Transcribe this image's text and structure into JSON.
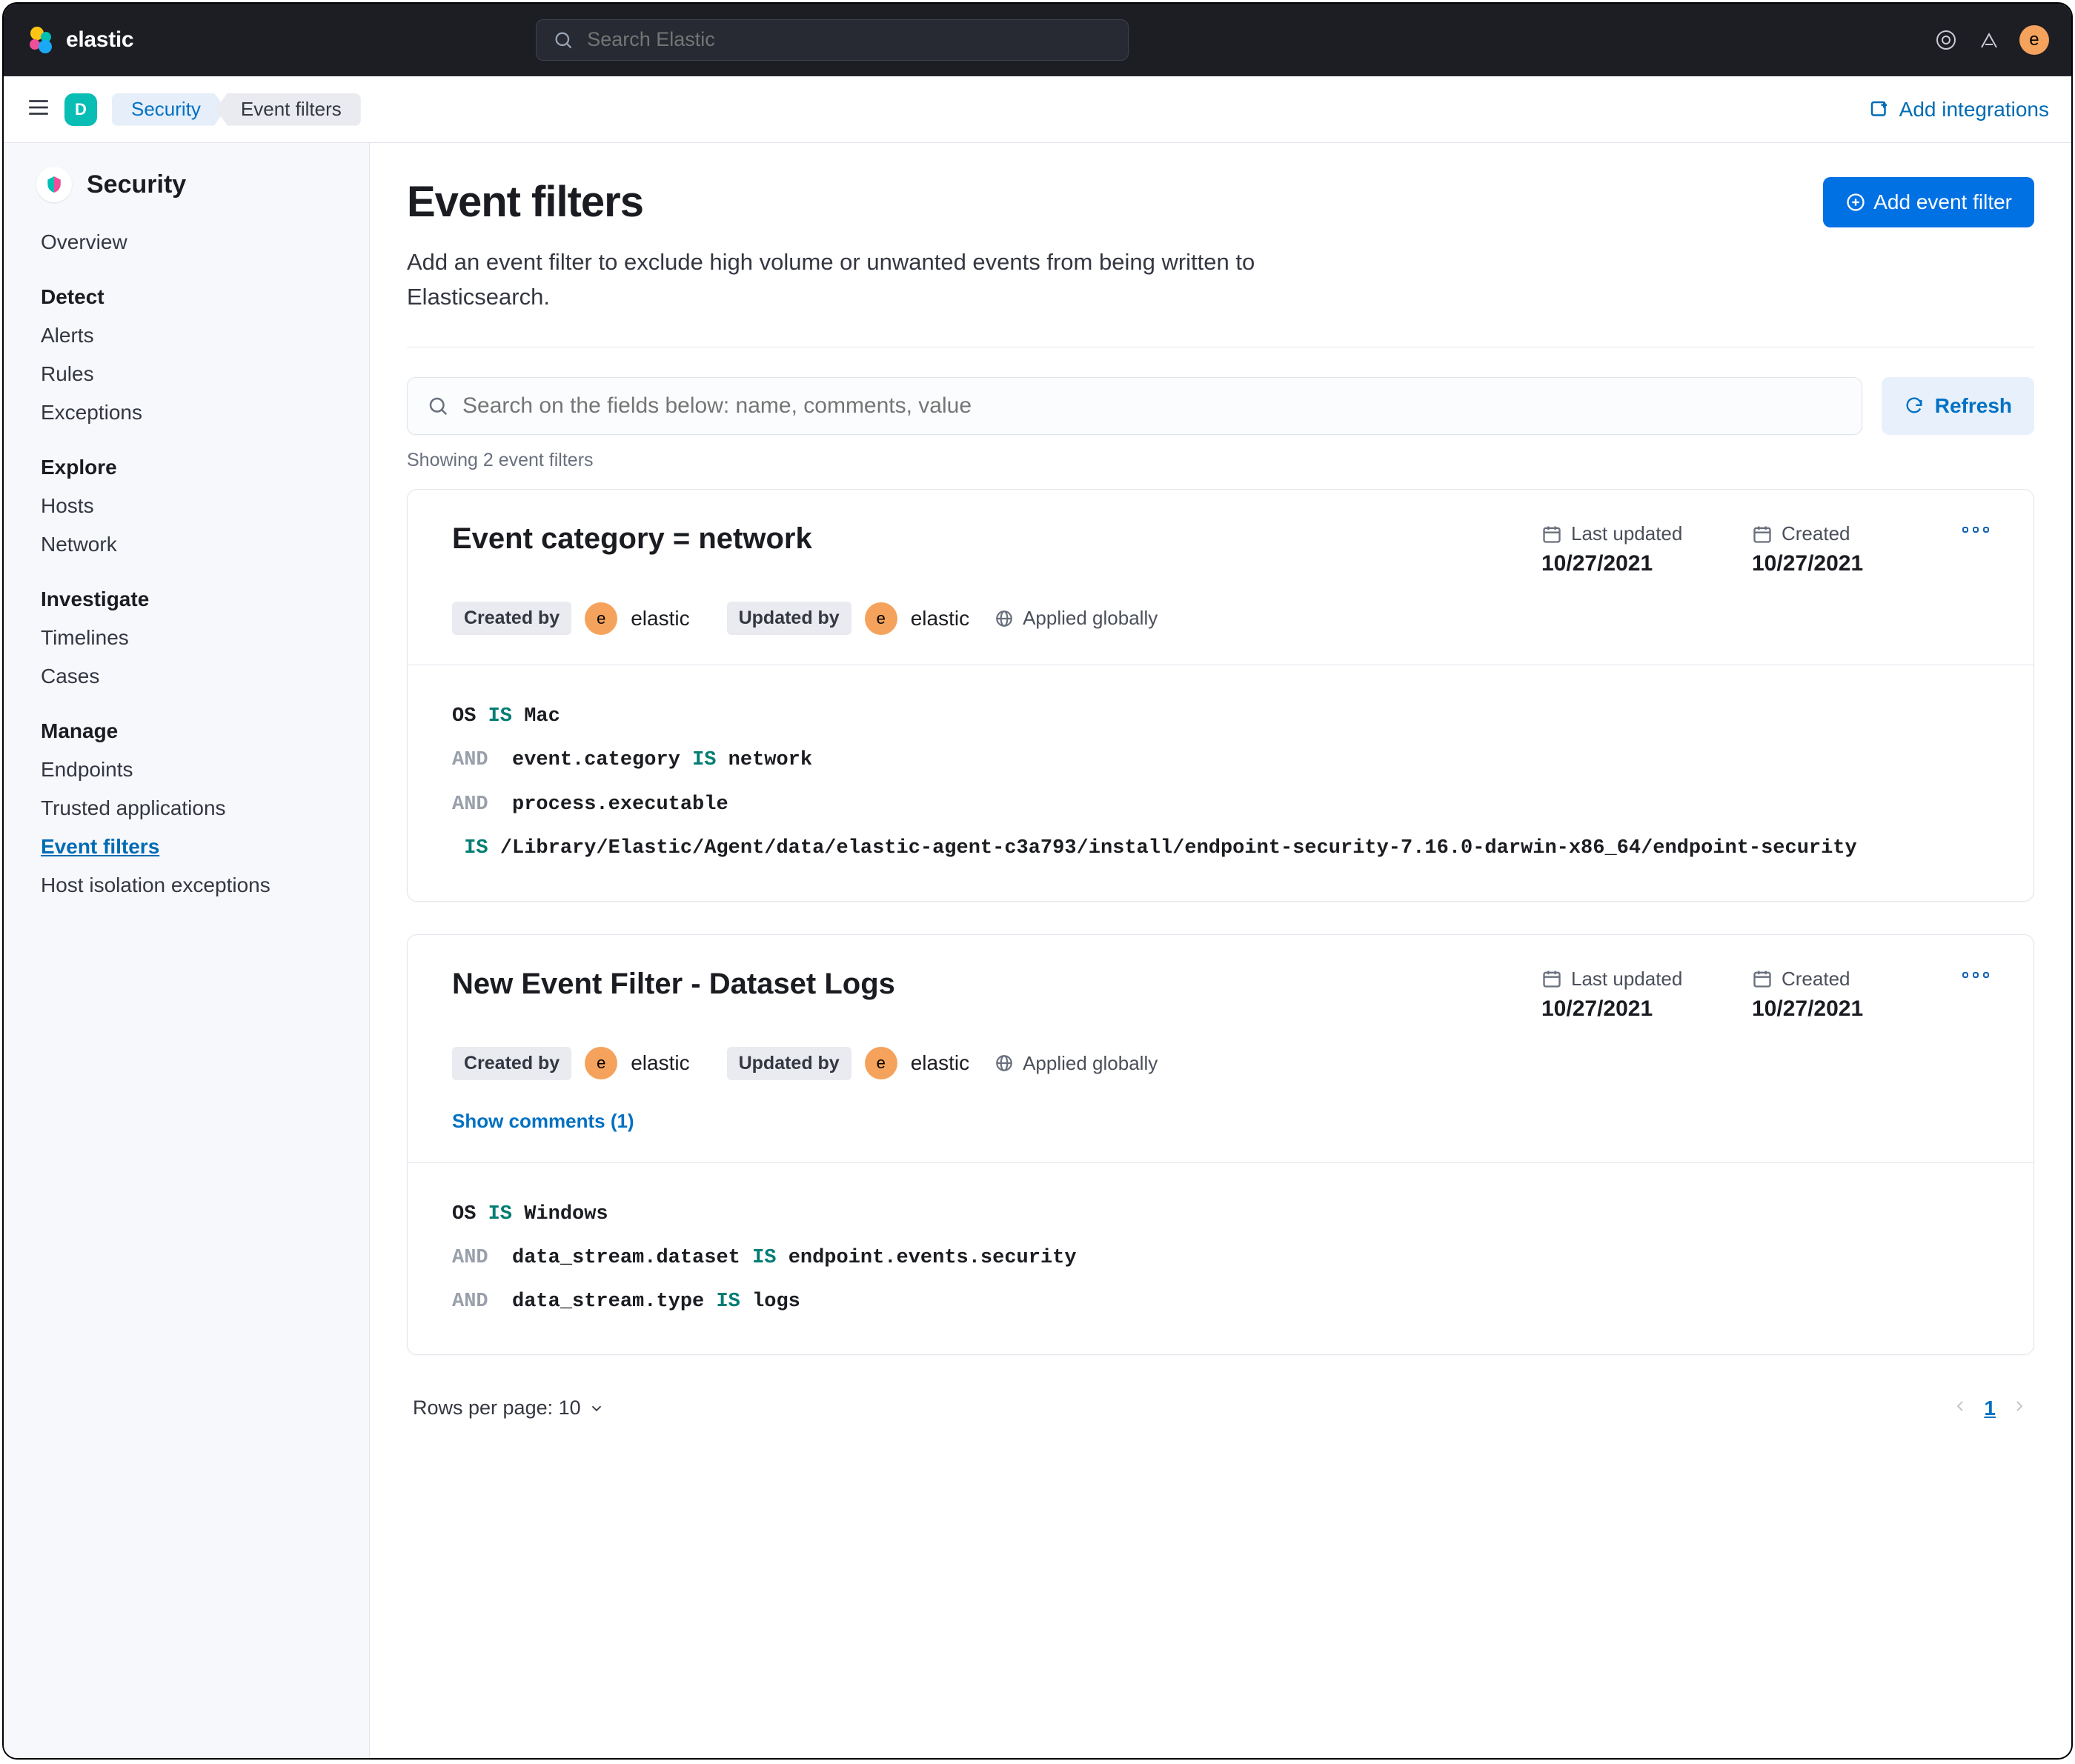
{
  "header": {
    "logo_text": "elastic",
    "search_placeholder": "Search Elastic",
    "avatar_letter": "e"
  },
  "subheader": {
    "space_letter": "D",
    "crumb_security": "Security",
    "crumb_page": "Event filters",
    "add_integrations": "Add integrations"
  },
  "sidebar": {
    "app_title": "Security",
    "overview": "Overview",
    "heading_detect": "Detect",
    "alerts": "Alerts",
    "rules": "Rules",
    "exceptions": "Exceptions",
    "heading_explore": "Explore",
    "hosts": "Hosts",
    "network": "Network",
    "heading_investigate": "Investigate",
    "timelines": "Timelines",
    "cases": "Cases",
    "heading_manage": "Manage",
    "endpoints": "Endpoints",
    "trusted_apps": "Trusted applications",
    "event_filters": "Event filters",
    "host_isolation": "Host isolation exceptions"
  },
  "page": {
    "title": "Event filters",
    "description": "Add an event filter to exclude high volume or unwanted events from being written to Elasticsearch.",
    "add_button": "Add event filter",
    "search_placeholder": "Search on the fields below: name, comments, value",
    "refresh": "Refresh",
    "showing": "Showing 2 event filters",
    "rows_per_page": "Rows per page: 10",
    "page_number": "1",
    "labels": {
      "last_updated": "Last updated",
      "created": "Created",
      "created_by": "Created by",
      "updated_by": "Updated by",
      "applied_globally": "Applied globally"
    }
  },
  "filters": [
    {
      "title": "Event category = network",
      "last_updated": "10/27/2021",
      "created": "10/27/2021",
      "created_by": "elastic",
      "created_by_initial": "e",
      "updated_by": "elastic",
      "updated_by_initial": "e",
      "comments": null,
      "conditions": [
        {
          "prefix_kw": null,
          "field": "OS",
          "op": "IS",
          "value": "Mac"
        },
        {
          "prefix_kw": "AND",
          "field": "event.category",
          "op": "IS",
          "value": "network"
        },
        {
          "prefix_kw": "AND",
          "field": "process.executable",
          "op": null,
          "value": null
        },
        {
          "prefix_kw": null,
          "field": null,
          "op": "IS",
          "value": "/Library/Elastic/Agent/data/elastic-agent-c3a793/install/endpoint-security-7.16.0-darwin-x86_64/endpoint-security",
          "indent": true
        }
      ]
    },
    {
      "title": "New Event Filter - Dataset Logs",
      "last_updated": "10/27/2021",
      "created": "10/27/2021",
      "created_by": "elastic",
      "created_by_initial": "e",
      "updated_by": "elastic",
      "updated_by_initial": "e",
      "comments": "Show comments (1)",
      "conditions": [
        {
          "prefix_kw": null,
          "field": "OS",
          "op": "IS",
          "value": "Windows"
        },
        {
          "prefix_kw": "AND",
          "field": "data_stream.dataset",
          "op": "IS",
          "value": "endpoint.events.security"
        },
        {
          "prefix_kw": "AND",
          "field": "data_stream.type",
          "op": "IS",
          "value": "logs"
        }
      ]
    }
  ]
}
